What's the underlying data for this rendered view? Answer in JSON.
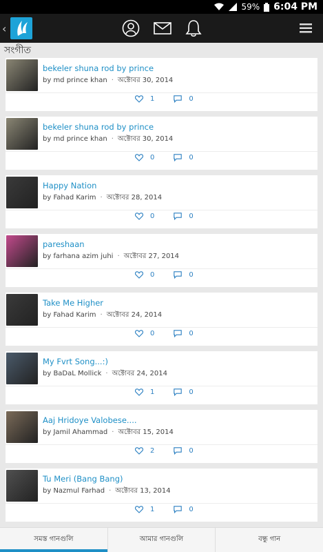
{
  "status_bar": {
    "battery": "59%",
    "time": "6:04 PM"
  },
  "header": {
    "back_icon": "chevron-left-icon",
    "logo_icon": "app-logo-icon",
    "profile_icon": "user-circle-icon",
    "mail_icon": "mail-icon",
    "bell_icon": "bell-icon",
    "menu_icon": "hamburger-menu-icon"
  },
  "section_title": "সংগীত",
  "songs": [
    {
      "title": "bekeler shuna rod by prince",
      "by": "by md prince khan",
      "date": "অক্টোবর 30, 2014",
      "likes": "1",
      "comments": "0",
      "thumb_color": "#8a8674"
    },
    {
      "title": "bekeler shuna rod by prince",
      "by": "by md prince khan",
      "date": "অক্টোবর 30, 2014",
      "likes": "0",
      "comments": "0",
      "thumb_color": "#8a8674"
    },
    {
      "title": "Happy Nation",
      "by": "by Fahad Karim",
      "date": "অক্টোবর 28, 2014",
      "likes": "0",
      "comments": "0",
      "thumb_color": "#3a3a3a"
    },
    {
      "title": "pareshaan",
      "by": "by farhana azim juhi",
      "date": "অক্টোবর 27, 2014",
      "likes": "0",
      "comments": "0",
      "thumb_color": "#c24a8c"
    },
    {
      "title": "Take Me Higher",
      "by": "by Fahad Karim",
      "date": "অক্টোবর 24, 2014",
      "likes": "0",
      "comments": "0",
      "thumb_color": "#3a3a3a"
    },
    {
      "title": "My Fvrt Song...:)",
      "by": "by BaDaL Mollick",
      "date": "অক্টোবর 24, 2014",
      "likes": "1",
      "comments": "0",
      "thumb_color": "#4a5a6a"
    },
    {
      "title": "Aaj Hridoye Valobese....",
      "by": "by Jamil Ahammad",
      "date": "অক্টোবর 15, 2014",
      "likes": "2",
      "comments": "0",
      "thumb_color": "#7a6a58"
    },
    {
      "title": "Tu Meri (Bang Bang)",
      "by": "by Nazmul Farhad",
      "date": "অক্টোবর 13, 2014",
      "likes": "1",
      "comments": "0",
      "thumb_color": "#505050"
    }
  ],
  "tabs": [
    {
      "label": "সমস্ত গানগুলি",
      "active": true
    },
    {
      "label": "আমার গানগুলি",
      "active": false
    },
    {
      "label": "বন্ধু গান",
      "active": false
    }
  ]
}
